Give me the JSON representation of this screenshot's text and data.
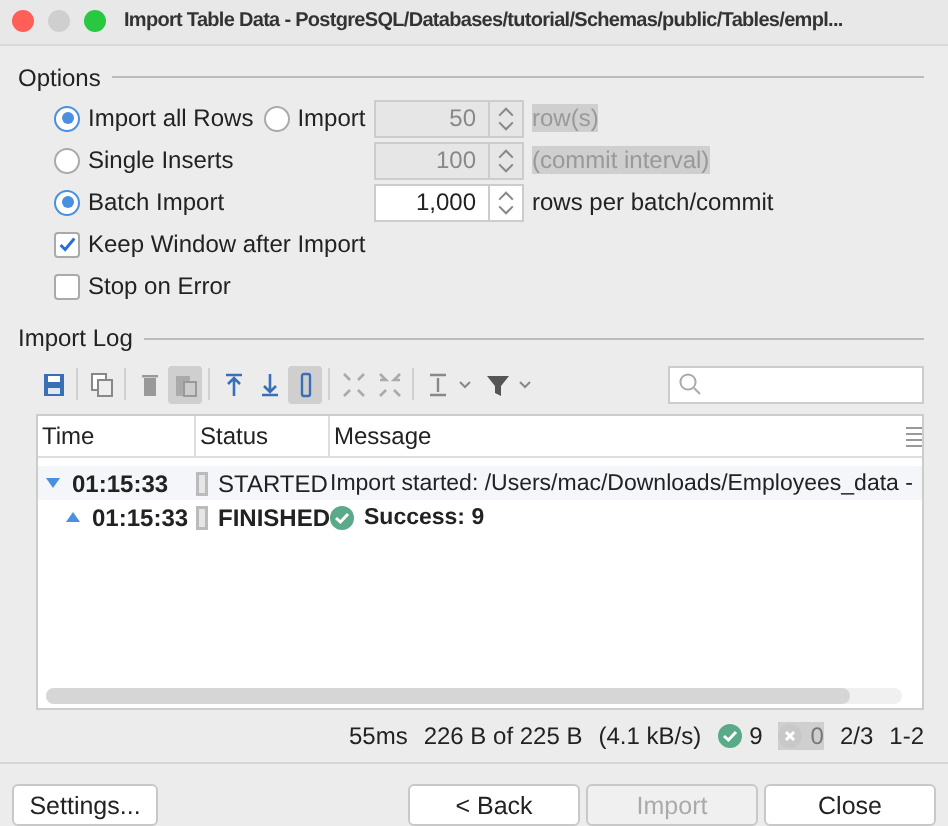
{
  "window": {
    "title": "Import Table Data - PostgreSQL/Databases/tutorial/Schemas/public/Tables/empl..."
  },
  "options": {
    "title": "Options",
    "rows": [
      {
        "kind": "radio",
        "items": [
          {
            "label": "Import all Rows",
            "selected": true
          },
          {
            "label": "Import",
            "selected": false
          }
        ],
        "field": {
          "value": "50",
          "disabled": true
        },
        "unit": "row(s)"
      },
      {
        "kind": "radio",
        "items": [
          {
            "label": "Single Inserts",
            "selected": false
          }
        ],
        "field": {
          "value": "100",
          "disabled": true
        },
        "unit": "(commit interval)"
      },
      {
        "kind": "radio",
        "items": [
          {
            "label": "Batch Import",
            "selected": true
          }
        ],
        "field": {
          "value": "1,000",
          "disabled": false
        },
        "unit": "rows per batch/commit"
      },
      {
        "kind": "checkbox",
        "label": "Keep Window after Import",
        "checked": true
      },
      {
        "kind": "checkbox",
        "label": "Stop on Error",
        "checked": false
      }
    ]
  },
  "log": {
    "title": "Import Log",
    "toolbar": [
      {
        "selected": false
      },
      {
        "selected": false
      },
      {
        "selected": false
      },
      {
        "selected": true
      },
      {
        "selected": false
      },
      {
        "selected": false
      },
      {
        "selected": true
      },
      {
        "selected": false
      },
      {
        "selected": false
      },
      {
        "selected": false
      },
      {
        "selected": false
      }
    ],
    "columns": [
      "Time",
      "Status",
      "Message"
    ],
    "rows": [
      {
        "kind": "info",
        "time": "01:15:33",
        "status": "STARTED",
        "message": "Import started: /Users/mac/Downloads/Employees_data -",
        "expanded": true,
        "children": [
          {
            "kind": "success",
            "time": "01:15:33",
            "status": "FINISHED",
            "message": "Success: 9"
          }
        ]
      }
    ]
  },
  "status_bar": {
    "time": "55ms",
    "bytes": "226 B of 225 B",
    "rate": "(4.1 kB/s)",
    "success_count": "9",
    "error_count": "0",
    "page": "2/3",
    "range": "1-2"
  },
  "buttons": [
    {
      "label": "Settings...",
      "disabled": false
    },
    {
      "label": "< Back",
      "disabled": false
    },
    {
      "label": "Import",
      "disabled": true
    },
    {
      "label": "Close",
      "disabled": false
    }
  ]
}
